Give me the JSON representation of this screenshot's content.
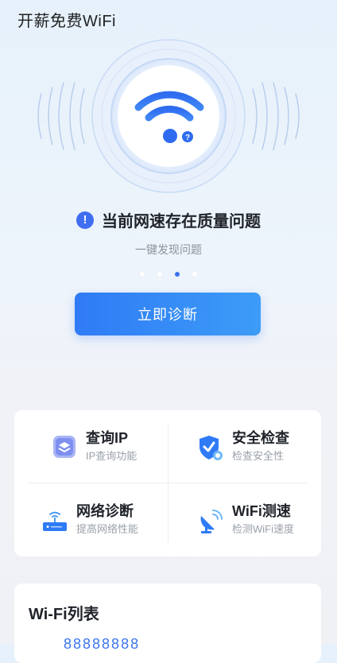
{
  "app": {
    "title": "开薪免费WiFi"
  },
  "status": {
    "alert_text": "当前网速存在质量问题",
    "alert_icon": "exclamation-circle-icon",
    "subtitle": "一键发现问题",
    "carousel_pages": 4,
    "carousel_active_index": 2
  },
  "cta": {
    "label": "立即诊断"
  },
  "tools": [
    {
      "name": "查询IP",
      "desc": "IP查询功能",
      "icon": "ip-query-icon"
    },
    {
      "name": "安全检查",
      "desc": "检查安全性",
      "icon": "shield-check-icon"
    },
    {
      "name": "网络诊断",
      "desc": "提高网络性能",
      "icon": "router-icon"
    },
    {
      "name": "WiFi测速",
      "desc": "检测WiFi速度",
      "icon": "satellite-dish-icon"
    }
  ],
  "wifi_list": {
    "title": "Wi-Fi列表",
    "first_item_partial": "88888888"
  },
  "colors": {
    "accent": "#3d74ee",
    "cta_start": "#2f7bf6",
    "cta_end": "#3d9cf7",
    "alert": "#3f6ef0"
  }
}
